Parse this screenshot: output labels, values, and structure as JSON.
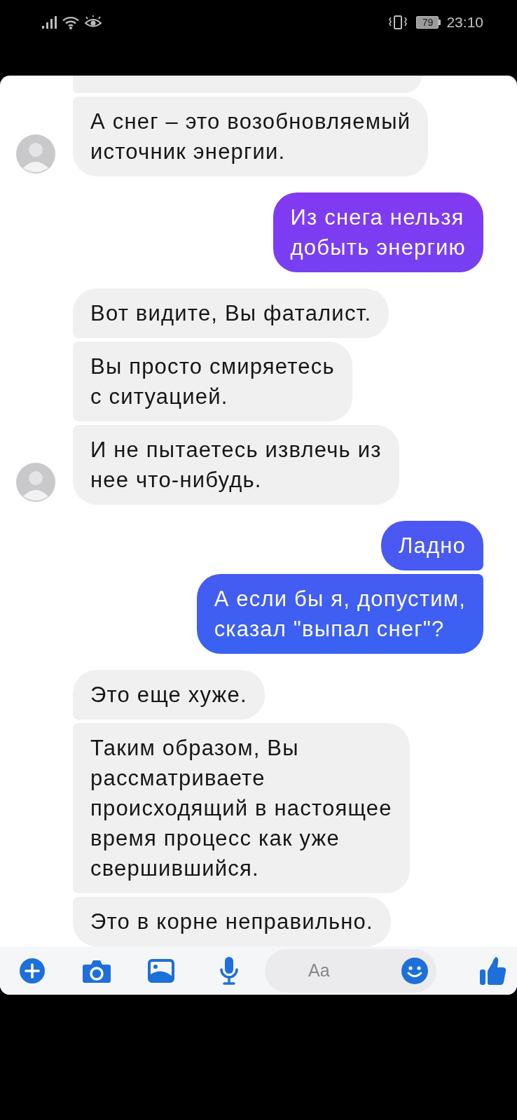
{
  "status_bar": {
    "battery": "79",
    "time": "23:10"
  },
  "messages": [
    {
      "outgoing": false
    },
    {
      "outgoing": false,
      "text": "А снег – это возобновляемый\nисточник энергии."
    },
    {
      "outgoing": true,
      "text": "Из снега нельзя\nдобыть энергию"
    },
    {
      "outgoing": false,
      "text": "Вот видите, Вы фаталист."
    },
    {
      "outgoing": false,
      "text": "Вы просто смиряетесь\nс ситуацией."
    },
    {
      "outgoing": false,
      "text": "И не пытаетесь извлечь из\nнее что-нибудь."
    },
    {
      "outgoing": true,
      "text": "Ладно"
    },
    {
      "outgoing": true,
      "text": "А если бы я, допустим,\nсказал \"выпал снег\"?"
    },
    {
      "outgoing": false,
      "text": "Это еще хуже."
    },
    {
      "outgoing": false,
      "text": "Таким образом, Вы\nрассматриваете\nпроисходящий в настоящее\nвремя процесс как уже\nсвершившийся."
    },
    {
      "outgoing": false,
      "text": "Это в корне неправильно."
    }
  ],
  "composer": {
    "placeholder": "Aa"
  }
}
